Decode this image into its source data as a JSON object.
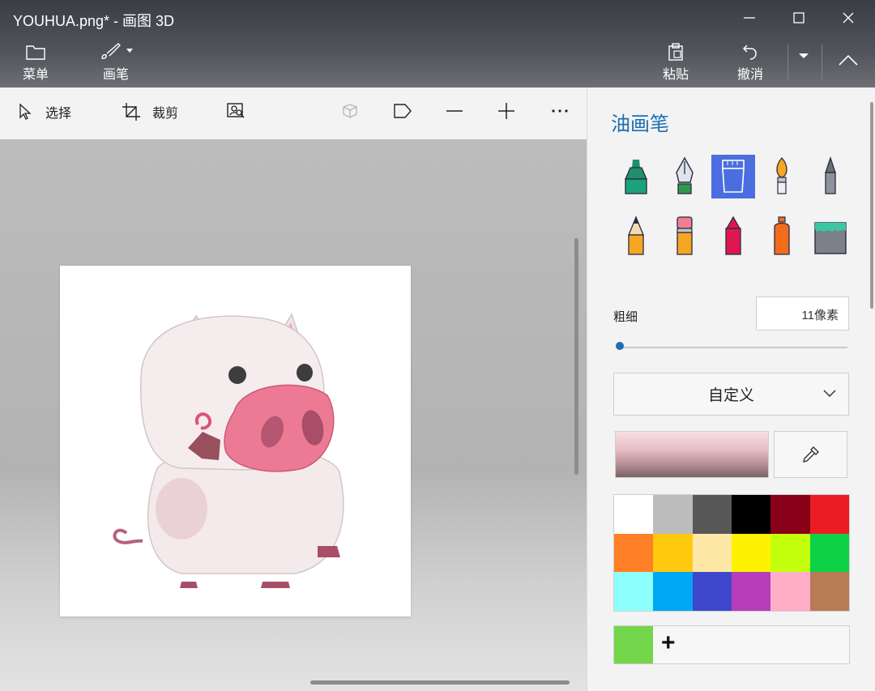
{
  "window": {
    "title": "YOUHUA.png* - 画图 3D",
    "controls": [
      "minimize-icon",
      "maximize-icon",
      "close-icon"
    ]
  },
  "ribbon": {
    "menu_label": "菜单",
    "brush_label": "画笔",
    "paste_label": "粘贴",
    "undo_label": "撤消"
  },
  "toolbar": {
    "select_label": "选择",
    "crop_label": "裁剪",
    "icons": [
      "magic-select-icon",
      "3d-view-icon",
      "flag-icon",
      "zoom-out-icon",
      "zoom-in-icon",
      "more-icon"
    ]
  },
  "panel": {
    "title": "油画笔",
    "brushes": [
      "marker-icon",
      "calligraphy-pen-icon",
      "oil-brush-icon",
      "watercolor-icon",
      "pixel-pen-icon",
      "pencil-icon",
      "eraser-icon",
      "crayon-icon",
      "spray-can-icon",
      "fill-bucket-icon"
    ],
    "selected_brush": "oil-brush-icon",
    "thickness_label": "粗细",
    "thickness_value": "11像素",
    "thickness_level": 0.02,
    "color_mode": "自定义",
    "palette": [
      "#ffffff",
      "#bcbcbc",
      "#585858",
      "#000000",
      "#890019",
      "#ec1c24",
      "#ff7f27",
      "#ffc90e",
      "#fde8a6",
      "#fff200",
      "#c4ff0e",
      "#0ed145",
      "#8cfffb",
      "#00a8f3",
      "#3f48cc",
      "#b83dba",
      "#ffaec8",
      "#b97a56"
    ],
    "custom_color": "#74d64a",
    "accent": "#1a6fb4"
  }
}
